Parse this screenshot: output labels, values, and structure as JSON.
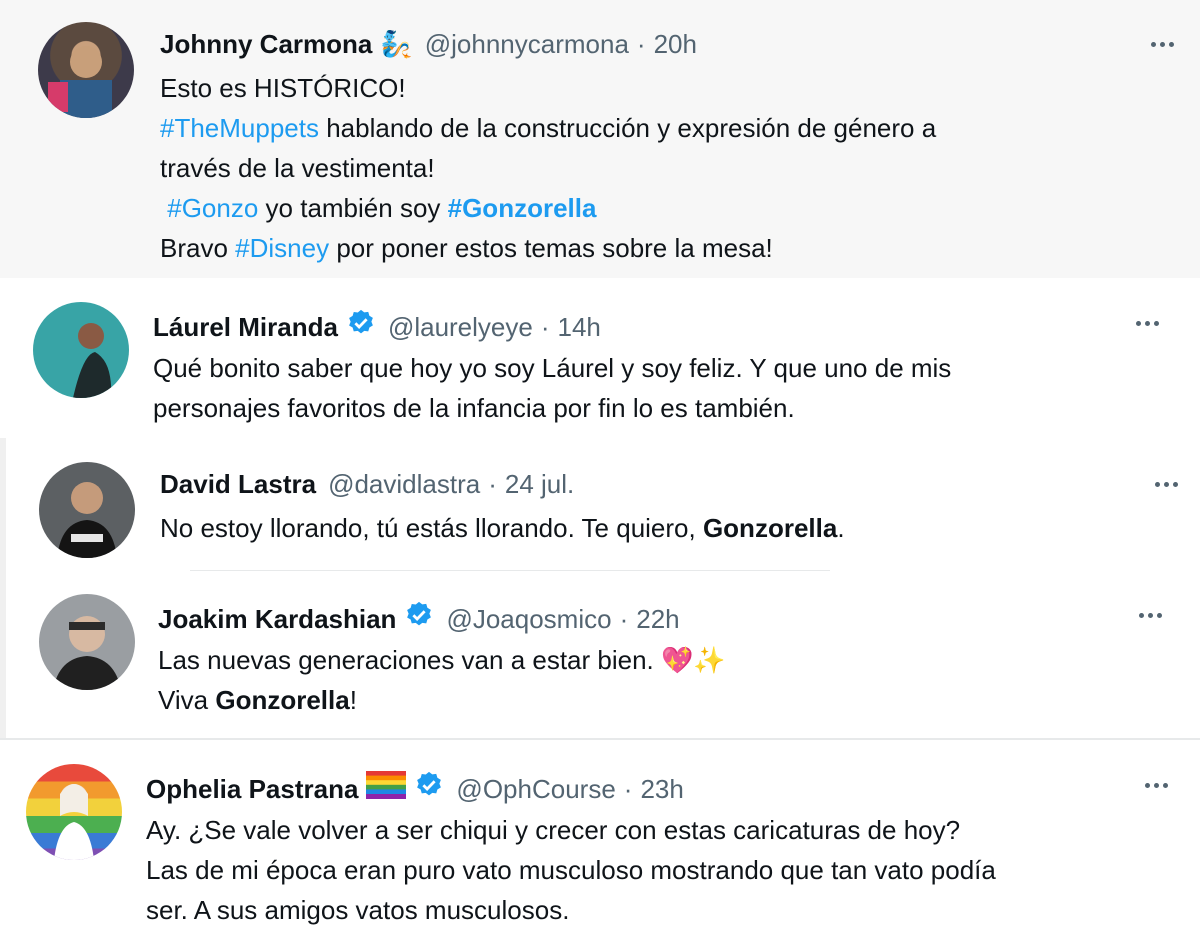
{
  "tweets": [
    {
      "name": "Johnny Carmona",
      "name_emoji": "🧞",
      "handle": "@johnnycarmona",
      "time": "20h",
      "lines": [
        "Esto es HISTÓRICO!",
        "#TheMuppets hablando de la construcción y expresión de género a",
        "través de la vestimenta!",
        " #Gonzo yo también soy #Gonzorella",
        "Bravo #Disney por poner estos temas sobre la mesa!"
      ],
      "avatar_color": "#6b5a4d"
    },
    {
      "name": "Láurel Miranda",
      "verified": true,
      "handle": "@laurelyeye",
      "time": "14h",
      "lines": [
        "Qué bonito saber que hoy yo soy Láurel y soy feliz. Y que uno de mis",
        "personajes favoritos de la infancia por fin lo es también."
      ],
      "avatar_color": "#3aa6a8"
    },
    {
      "name": "David Lastra",
      "handle": "@davidlastra",
      "time": "24 jul.",
      "lines": [
        "No estoy llorando, tú estás llorando. Te quiero, Gonzorella."
      ],
      "avatar_color": "#4b4f52"
    },
    {
      "name": "Joakim Kardashian",
      "verified": true,
      "handle": "@Joaqosmico",
      "time": "22h",
      "lines": [
        "Las nuevas generaciones van a estar bien. ❤️✨",
        "Viva Gonzorella!"
      ],
      "avatar_color": "#7b7f83"
    },
    {
      "name": "Ophelia Pastrana",
      "verified": true,
      "flag": "🏳️‍🌈",
      "handle": "@OphCourse",
      "time": "23h",
      "lines": [
        "Ay. ¿Se vale volver a ser chiqui y crecer con estas caricaturas de hoy?",
        "Las de mi época eran puro vato musculoso mostrando que tan vato podía",
        "ser. A sus amigos vatos musculosos."
      ],
      "avatar_color": "#e8a33a"
    }
  ],
  "parts": {
    "t0_l1a": "#TheMuppets",
    "t0_l1b": " hablando de la construcción y expresión de género a",
    "t0_l3a": "#Gonzo",
    "t0_l3b": " yo también soy ",
    "t0_l3c": "#Gonzorella",
    "t0_l4a": "Bravo ",
    "t0_l4b": "#Disney",
    "t0_l4c": " por poner estos temas sobre la mesa!",
    "t2_a": "No estoy llorando, tú estás llorando. Te quiero, ",
    "t2_b": "Gonzorella",
    "t2_c": ".",
    "t3_a": "Las nuevas generaciones van a estar bien. ",
    "t3_emoji": "💖✨",
    "t3_b": "Viva ",
    "t3_c": "Gonzorella",
    "t3_d": "!"
  },
  "colors": {
    "link": "#1d9bf0",
    "muted": "#536471",
    "verified": "#1d9bf0",
    "highlight_bg": "#f5f8fa"
  }
}
